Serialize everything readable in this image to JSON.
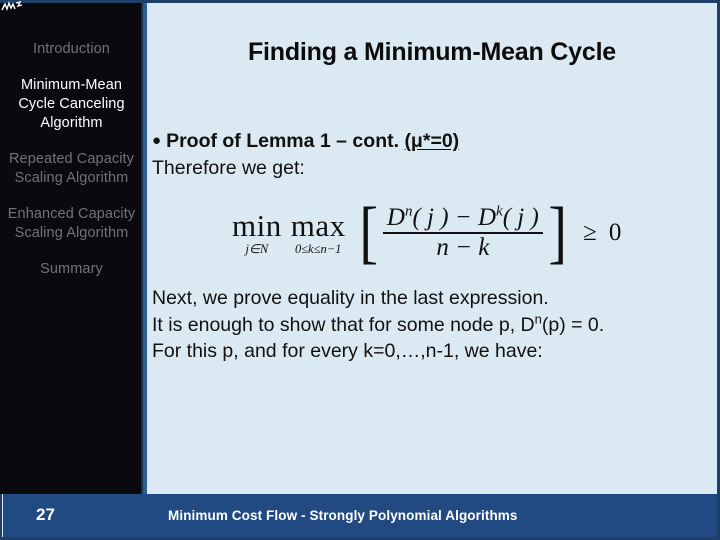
{
  "slide": {
    "background_color": "#dbeaf2",
    "border_color": "#1f3f66",
    "title": "Finding a Minimum-Mean Cycle"
  },
  "sidebar": {
    "background_color": "#0a0a0e",
    "accent_color": "#2e5d92",
    "inactive_color": "#6f7378",
    "active_color": "#ffffff",
    "items": [
      {
        "label": "Introduction",
        "active": false
      },
      {
        "label": "Minimum-Mean Cycle Canceling Algorithm",
        "active": true
      },
      {
        "label": "Repeated Capacity Scaling Algorithm",
        "active": false
      },
      {
        "label": "Enhanced Capacity Scaling Algorithm",
        "active": false
      },
      {
        "label": "Summary",
        "active": false
      }
    ]
  },
  "content": {
    "bullet_dot": "●",
    "bullet_prefix": "Proof of Lemma 1 – cont. ",
    "bullet_underlined": "(μ*=0)",
    "subline": "Therefore we get:",
    "paragraph_lines": [
      "Next, we prove equality in the last expression.",
      "It is enough to show that for some node p,  D",
      "For this p, and for every k=0,…,n-1, we have:"
    ],
    "paragraph_line2_sup": "n",
    "paragraph_line2_tail": "(p) = 0."
  },
  "formula": {
    "min_label": "min",
    "min_sub": "j∈N",
    "max_label": "max",
    "max_sub": "0≤k≤n−1",
    "bracket_open": "[",
    "bracket_close": "]",
    "numerator_first": "D",
    "numerator_first_sup": "n",
    "numerator_first_arg": "( j )",
    "numerator_minus": "−",
    "numerator_second": "D",
    "numerator_second_sup": "k",
    "numerator_second_arg": "( j )",
    "denominator": "n − k",
    "relation": "≥",
    "right_side": "0"
  },
  "footer": {
    "background_color": "#224a82",
    "page_number": "27",
    "text": "Minimum Cost Flow - Strongly Polynomial Algorithms"
  }
}
